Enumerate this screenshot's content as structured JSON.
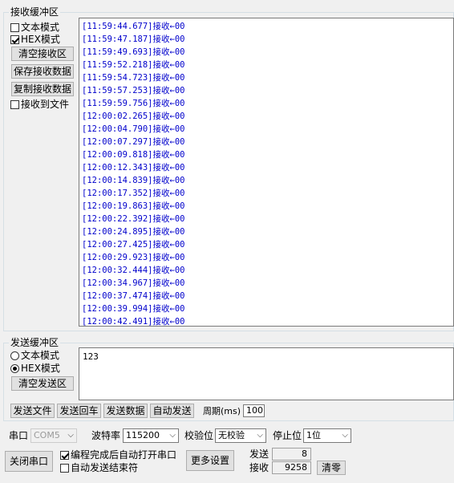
{
  "receive": {
    "group_title": "接收缓冲区",
    "text_mode_label": "文本模式",
    "hex_mode_label": "HEX模式",
    "text_mode_checked": false,
    "hex_mode_checked": true,
    "clear_button": "清空接收区",
    "save_button": "保存接收数据",
    "copy_button": "复制接收数据",
    "to_file_label": "接收到文件",
    "to_file_checked": false,
    "lines": [
      "[11:59:44.677]接收←00",
      "[11:59:47.187]接收←00",
      "[11:59:49.693]接收←00",
      "[11:59:52.218]接收←00",
      "[11:59:54.723]接收←00",
      "[11:59:57.253]接收←00",
      "[11:59:59.756]接收←00",
      "[12:00:02.265]接收←00",
      "[12:00:04.790]接收←00",
      "[12:00:07.297]接收←00",
      "[12:00:09.818]接收←00",
      "[12:00:12.343]接收←00",
      "[12:00:14.839]接收←00",
      "[12:00:17.352]接收←00",
      "[12:00:19.863]接收←00",
      "[12:00:22.392]接收←00",
      "[12:00:24.895]接收←00",
      "[12:00:27.425]接收←00",
      "[12:00:29.923]接收←00",
      "[12:00:32.444]接收←00",
      "[12:00:34.967]接收←00",
      "[12:00:37.474]接收←00",
      "[12:00:39.994]接收←00",
      "[12:00:42.491]接收←00"
    ]
  },
  "send": {
    "group_title": "发送缓冲区",
    "text_mode_label": "文本模式",
    "hex_mode_label": "HEX模式",
    "selected_mode": "hex",
    "clear_button": "清空发送区",
    "content": "123",
    "buttons": {
      "send_file": "发送文件",
      "send_echo": "发送回车",
      "send_data": "发送数据",
      "auto_send": "自动发送"
    },
    "period_label": "周期(ms)",
    "period_value": "100"
  },
  "port": {
    "port_label": "串口",
    "port_value": "COM5",
    "baud_label": "波特率",
    "baud_value": "115200",
    "parity_label": "校验位",
    "parity_value": "无校验",
    "stopbits_label": "停止位",
    "stopbits_value": "1位",
    "close_button": "关闭串口",
    "auto_open_label": "编程完成后自动打开串口",
    "auto_open_checked": true,
    "auto_end_label": "自动发送结束符",
    "auto_end_checked": false,
    "more_settings_button": "更多设置",
    "sent_label": "发送",
    "sent_count": "8",
    "recv_label": "接收",
    "recv_count": "9258",
    "clear_count_button": "清零"
  },
  "colors": {
    "background": "#f0f0f0",
    "rx_text": "#0000cc"
  }
}
